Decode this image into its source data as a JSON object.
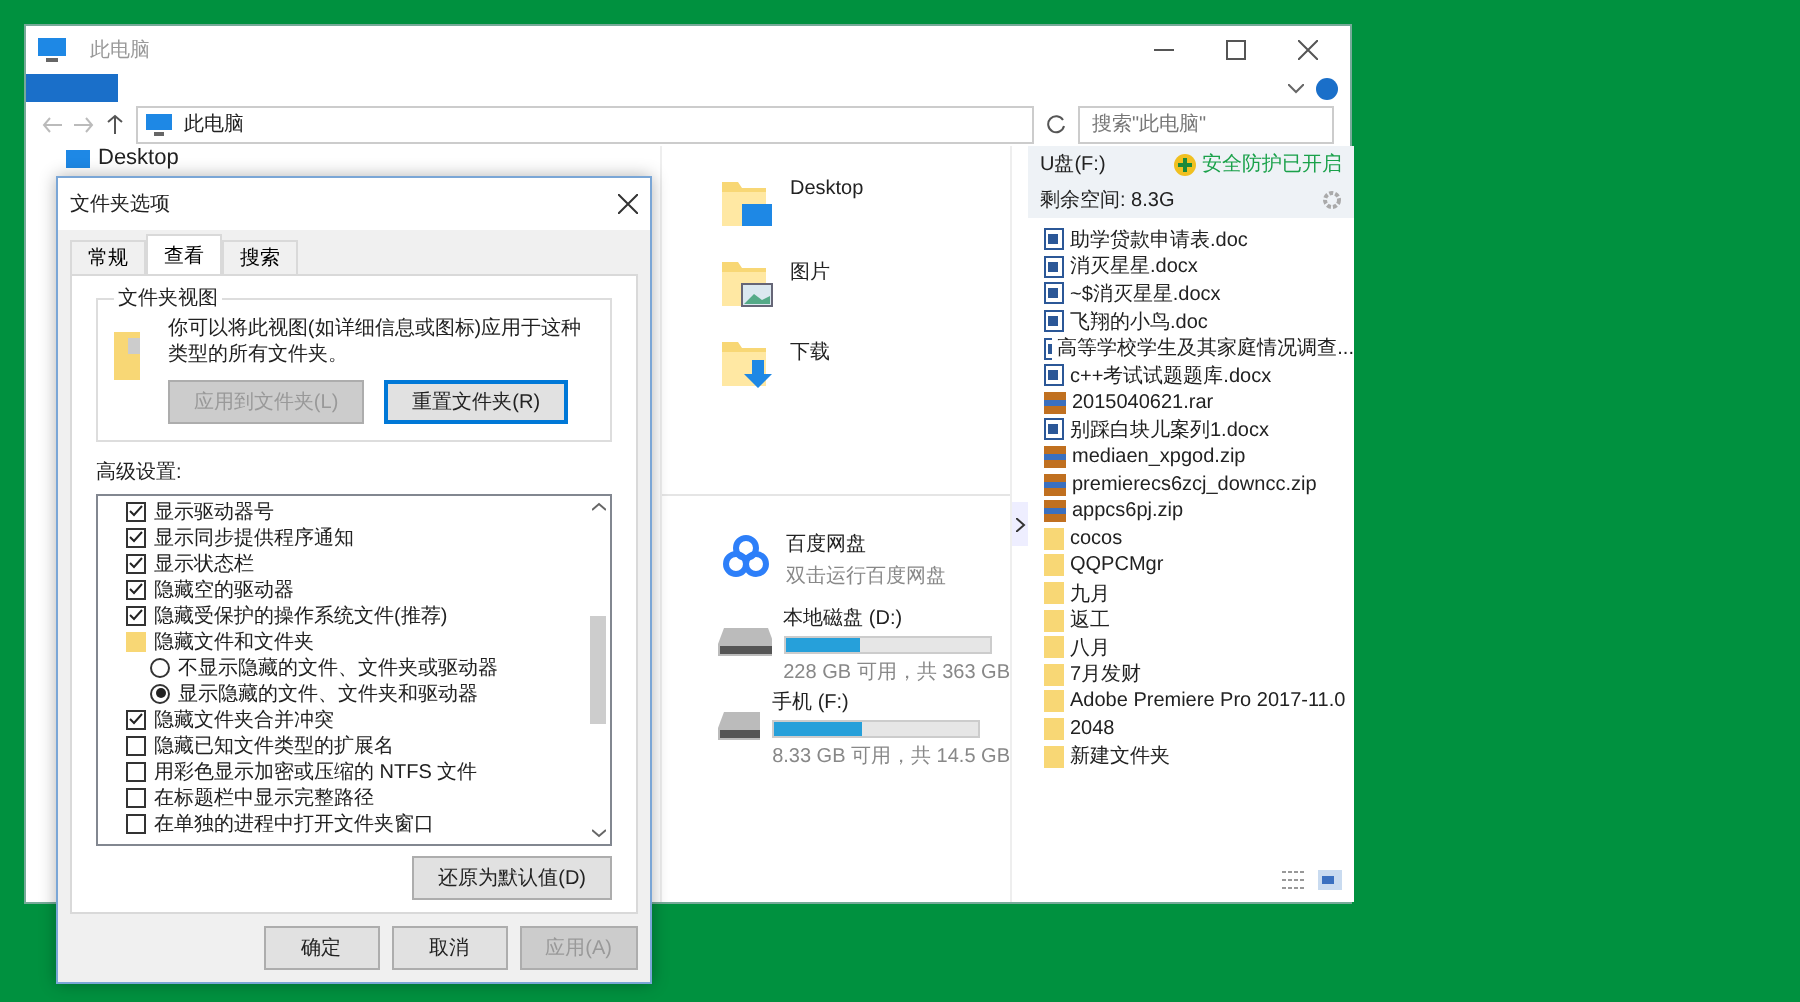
{
  "explorer": {
    "title": "此电脑",
    "address": "此电脑",
    "search": {
      "placeholder": "搜索\"此电脑\""
    },
    "nav_pane": {
      "items": [
        {
          "label": "Desktop"
        }
      ]
    },
    "folders": [
      {
        "name": "Desktop",
        "kind": "desktop"
      },
      {
        "name": "图片",
        "kind": "pictures"
      },
      {
        "name": "下载",
        "kind": "downloads"
      }
    ],
    "devices": [
      {
        "kind": "app",
        "name": "百度网盘",
        "subtitle": "双击运行百度网盘"
      },
      {
        "kind": "drive",
        "name": "本地磁盘 (D:)",
        "level": 0.37,
        "subtitle": "228 GB 可用，共 363 GB"
      },
      {
        "kind": "drive",
        "name": "手机 (F:)",
        "level": 0.43,
        "subtitle": "8.33 GB 可用，共 14.5 GB"
      }
    ]
  },
  "usb_panel": {
    "title": "U盘(F:)",
    "status": "安全防护已开启",
    "free_space": "剩余空间: 8.3G",
    "files": [
      {
        "name": "助学贷款申请表.doc",
        "kind": "doc"
      },
      {
        "name": "消灭星星.docx",
        "kind": "doc"
      },
      {
        "name": "~$消灭星星.docx",
        "kind": "doc"
      },
      {
        "name": "飞翔的小鸟.doc",
        "kind": "doc"
      },
      {
        "name": "高等学校学生及其家庭情况调查...",
        "kind": "doc"
      },
      {
        "name": "c++考试试题题库.docx",
        "kind": "doc"
      },
      {
        "name": "2015040621.rar",
        "kind": "archive"
      },
      {
        "name": "别踩白块儿案列1.docx",
        "kind": "doc"
      },
      {
        "name": "mediaen_xpgod.zip",
        "kind": "archive"
      },
      {
        "name": "premierecs6zcj_downcc.zip",
        "kind": "archive"
      },
      {
        "name": "appcs6pj.zip",
        "kind": "archive"
      },
      {
        "name": "cocos",
        "kind": "folder"
      },
      {
        "name": "QQPCMgr",
        "kind": "folder"
      },
      {
        "name": "九月",
        "kind": "folder"
      },
      {
        "name": "返工",
        "kind": "folder"
      },
      {
        "name": "八月",
        "kind": "folder"
      },
      {
        "name": "7月发财",
        "kind": "folder"
      },
      {
        "name": "Adobe Premiere Pro 2017-11.0",
        "kind": "folder"
      },
      {
        "name": "2048",
        "kind": "folder"
      },
      {
        "name": "新建文件夹",
        "kind": "folder"
      }
    ]
  },
  "dialog": {
    "title": "文件夹选项",
    "tabs": [
      {
        "label": "常规",
        "selected": false
      },
      {
        "label": "查看",
        "selected": true
      },
      {
        "label": "搜索",
        "selected": false
      }
    ],
    "folder_view": {
      "title": "文件夹视图",
      "description": "你可以将此视图(如详细信息或图标)应用于这种类型的所有文件夹。",
      "buttons": [
        {
          "label": "应用到文件夹(L)",
          "disabled": true
        },
        {
          "label": "重置文件夹(R)",
          "disabled": false
        }
      ]
    },
    "advanced_label": "高级设置:",
    "settings": [
      {
        "kind": "checkbox",
        "label": "显示驱动器号",
        "checked": true
      },
      {
        "kind": "checkbox",
        "label": "显示同步提供程序通知",
        "checked": true
      },
      {
        "kind": "checkbox",
        "label": "显示状态栏",
        "checked": true
      },
      {
        "kind": "checkbox",
        "label": "隐藏空的驱动器",
        "checked": true
      },
      {
        "kind": "checkbox",
        "label": "隐藏受保护的操作系统文件(推荐)",
        "checked": true
      },
      {
        "kind": "group",
        "label": "隐藏文件和文件夹"
      },
      {
        "kind": "radio",
        "label": "不显示隐藏的文件、文件夹或驱动器",
        "selected": false
      },
      {
        "kind": "radio",
        "label": "显示隐藏的文件、文件夹和驱动器",
        "selected": true
      },
      {
        "kind": "checkbox",
        "label": "隐藏文件夹合并冲突",
        "checked": true
      },
      {
        "kind": "checkbox",
        "label": "隐藏已知文件类型的扩展名",
        "checked": false
      },
      {
        "kind": "checkbox",
        "label": "用彩色显示加密或压缩的 NTFS 文件",
        "checked": false
      },
      {
        "kind": "checkbox",
        "label": "在标题栏中显示完整路径",
        "checked": false
      },
      {
        "kind": "checkbox",
        "label": "在单独的进程中打开文件夹窗口",
        "checked": false
      }
    ],
    "restore_button": {
      "label": "还原为默认值(D)"
    },
    "buttons": [
      {
        "label": "确定",
        "disabled": false
      },
      {
        "label": "取消",
        "disabled": false
      },
      {
        "label": "应用(A)",
        "disabled": true
      }
    ]
  }
}
